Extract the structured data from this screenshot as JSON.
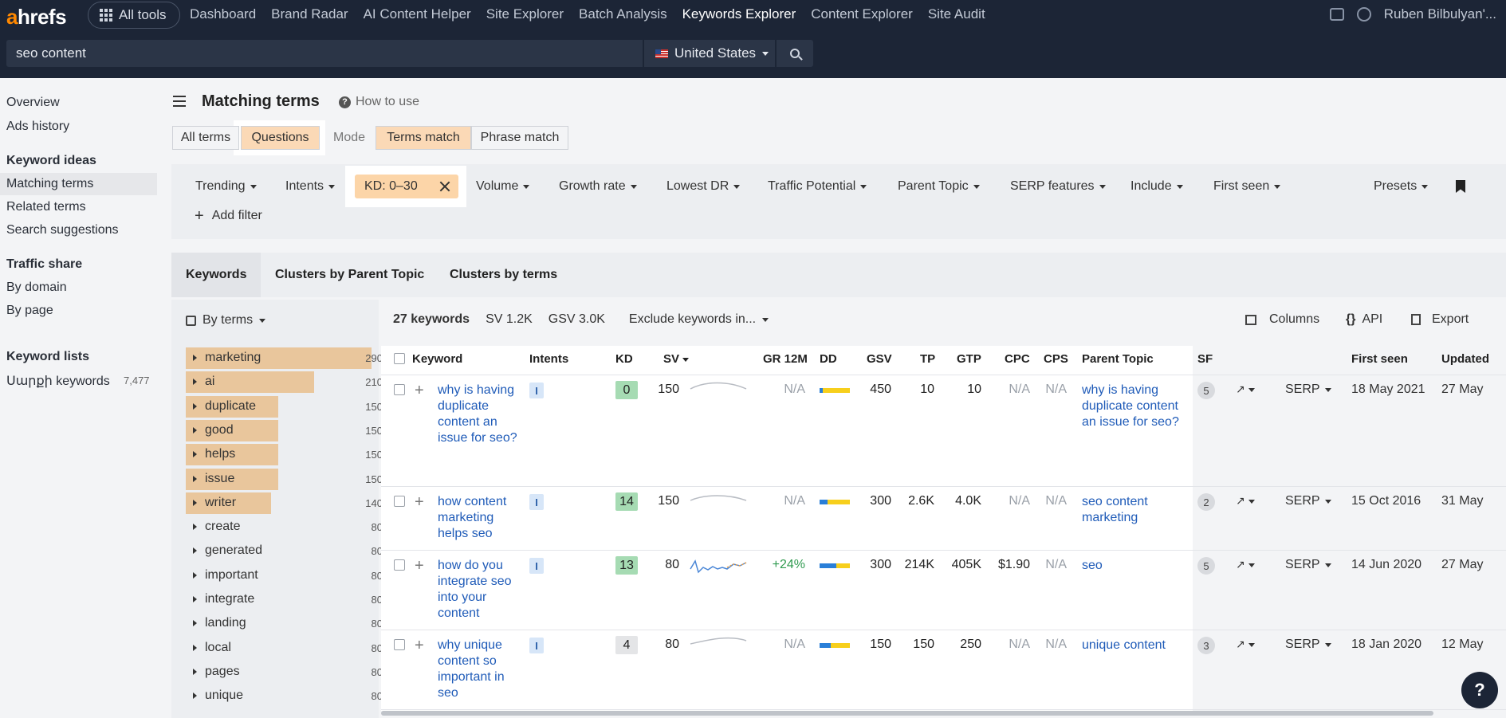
{
  "nav": {
    "logo_a": "a",
    "logo_rest": "hrefs",
    "all_tools": "All tools",
    "links": [
      "Dashboard",
      "Brand Radar",
      "AI Content Helper",
      "Site Explorer",
      "Batch Analysis",
      "Keywords Explorer",
      "Content Explorer",
      "Site Audit"
    ],
    "active": "Keywords Explorer",
    "user": "Ruben Bilbulyan'..."
  },
  "search": {
    "query": "seo content",
    "country": "United States"
  },
  "sidebar": {
    "overview": "Overview",
    "ads_history": "Ads history",
    "keyword_ideas": "Keyword ideas",
    "matching_terms": "Matching terms",
    "related_terms": "Related terms",
    "search_suggestions": "Search suggestions",
    "traffic_share": "Traffic share",
    "by_domain": "By domain",
    "by_page": "By page",
    "keyword_lists": "Keyword lists",
    "list_name": "Սարքի keywords",
    "list_count": "7,477"
  },
  "header": {
    "title": "Matching terms",
    "how_to": "How to use"
  },
  "segments": {
    "all_terms": "All terms",
    "questions": "Questions",
    "mode": "Mode",
    "terms_match": "Terms match",
    "phrase_match": "Phrase match"
  },
  "filters": {
    "trending": "Trending",
    "intents": "Intents",
    "kd": "KD: 0–30",
    "volume": "Volume",
    "growth_rate": "Growth rate",
    "lowest_dr": "Lowest DR",
    "traffic_potential": "Traffic Potential",
    "parent_topic": "Parent Topic",
    "serp_features": "SERP features",
    "include": "Include",
    "first_seen": "First seen",
    "presets": "Presets",
    "add_filter": "Add filter"
  },
  "tabs": {
    "keywords": "Keywords",
    "clusters_parent": "Clusters by Parent Topic",
    "clusters_terms": "Clusters by terms"
  },
  "terms_panel": {
    "by_terms": "By terms",
    "terms": [
      {
        "label": "marketing",
        "count": "290",
        "frac": 1.0
      },
      {
        "label": "ai",
        "count": "210",
        "frac": 0.72
      },
      {
        "label": "duplicate",
        "count": "150",
        "frac": 0.52
      },
      {
        "label": "good",
        "count": "150",
        "frac": 0.52
      },
      {
        "label": "helps",
        "count": "150",
        "frac": 0.52
      },
      {
        "label": "issue",
        "count": "150",
        "frac": 0.52
      },
      {
        "label": "writer",
        "count": "140",
        "frac": 0.48
      },
      {
        "label": "create",
        "count": "80",
        "frac": 0.0
      },
      {
        "label": "generated",
        "count": "80",
        "frac": 0.0
      },
      {
        "label": "important",
        "count": "80",
        "frac": 0.0
      },
      {
        "label": "integrate",
        "count": "80",
        "frac": 0.0
      },
      {
        "label": "landing",
        "count": "80",
        "frac": 0.0
      },
      {
        "label": "local",
        "count": "80",
        "frac": 0.0
      },
      {
        "label": "pages",
        "count": "80",
        "frac": 0.0
      },
      {
        "label": "unique",
        "count": "80",
        "frac": 0.0
      }
    ]
  },
  "summary": {
    "keywords": "27 keywords",
    "sv": "SV 1.2K",
    "gsv": "GSV 3.0K",
    "exclude": "Exclude keywords in...",
    "columns": "Columns",
    "api": "API",
    "export": "Export"
  },
  "table": {
    "headers": {
      "keyword": "Keyword",
      "intents": "Intents",
      "kd": "KD",
      "sv": "SV",
      "gr": "GR 12M",
      "dd": "DD",
      "gsv": "GSV",
      "tp": "TP",
      "gtp": "GTP",
      "cpc": "CPC",
      "cps": "CPS",
      "parent_topic": "Parent Topic",
      "sf": "SF",
      "first_seen": "First seen",
      "updated": "Updated"
    },
    "rows": [
      {
        "kw": "why is having duplicate content an issue for seo?",
        "intent": "I",
        "kd": "0",
        "kd_color": "#a6dbb3",
        "sv": "150",
        "gr": "N/A",
        "dd": 0.1,
        "gsv": "450",
        "tp": "10",
        "gtp": "10",
        "cpc": "N/A",
        "cps": "N/A",
        "pt": "why is having duplicate content an issue for seo?",
        "sf": "5",
        "serp": "SERP",
        "first": "18 May 2021",
        "upd": "27 May"
      },
      {
        "kw": "how content marketing helps seo",
        "intent": "I",
        "kd": "14",
        "kd_color": "#a6dbb3",
        "sv": "150",
        "gr": "N/A",
        "dd": 0.25,
        "gsv": "300",
        "tp": "2.6K",
        "gtp": "4.0K",
        "cpc": "N/A",
        "cps": "N/A",
        "pt": "seo content marketing",
        "sf": "2",
        "serp": "SERP",
        "first": "15 Oct 2016",
        "upd": "31 May"
      },
      {
        "kw": "how do you integrate seo into your content",
        "intent": "I",
        "kd": "13",
        "kd_color": "#a6dbb3",
        "sv": "80",
        "gr": "+24%",
        "dd": 0.55,
        "gsv": "300",
        "tp": "214K",
        "gtp": "405K",
        "cpc": "$1.90",
        "cps": "N/A",
        "pt": "seo",
        "sf": "5",
        "serp": "SERP",
        "first": "14 Jun 2020",
        "upd": "27 May"
      },
      {
        "kw": "why unique content so important in seo",
        "intent": "I",
        "kd": "4",
        "kd_color": "#e4e5e7",
        "sv": "80",
        "gr": "N/A",
        "dd": 0.38,
        "gsv": "150",
        "tp": "150",
        "gtp": "250",
        "cpc": "N/A",
        "cps": "N/A",
        "pt": "unique content",
        "sf": "3",
        "serp": "SERP",
        "first": "18 Jan 2020",
        "upd": "12 May"
      }
    ]
  },
  "help": "?"
}
